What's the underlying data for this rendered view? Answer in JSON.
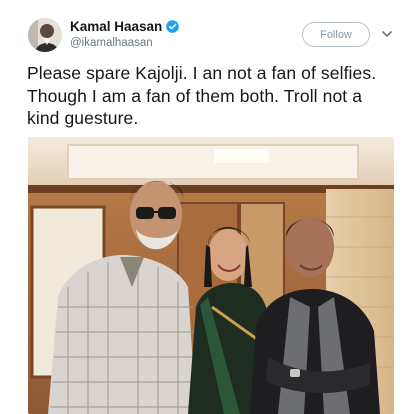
{
  "tweet": {
    "author": {
      "display_name": "Kamal Haasan",
      "handle": "@ikamalhaasan",
      "verified": true,
      "avatar_icon": "profile-photo"
    },
    "follow_label": "Follow",
    "menu_icon": "chevron-down-icon",
    "text_lines": [
      "Please spare Kajolji.  I an not a fan of selfies.",
      "Though I am a fan of them both. Troll not a",
      "kind guesture."
    ],
    "media": {
      "type": "photo"
    }
  },
  "colors": {
    "verified_blue": "#1da1f2",
    "text": "#14171a",
    "secondary_text": "#657786",
    "button_border": "#b9c4cc"
  }
}
